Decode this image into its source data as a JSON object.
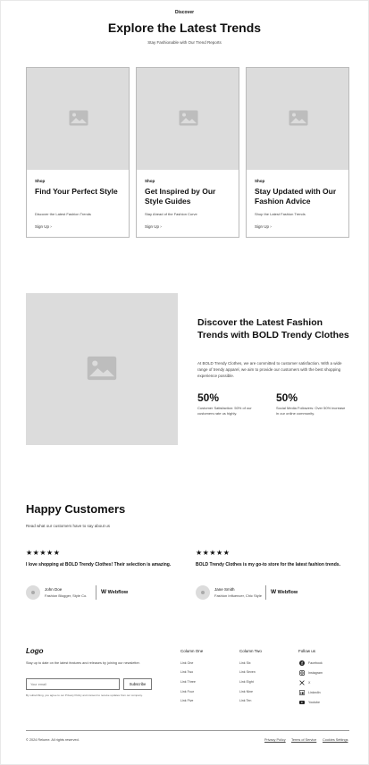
{
  "hero": {
    "eyebrow": "Discover",
    "title": "Explore the Latest Trends",
    "subtitle": "Stay Fashionable with Our Trend Reports"
  },
  "cards": [
    {
      "tag": "Shop",
      "title": "Find Your Perfect Style",
      "desc": "Discover the Latest Fashion Trends",
      "link": "Sign Up"
    },
    {
      "tag": "Shop",
      "title": "Get Inspired by Our Style Guides",
      "desc": "Stay Ahead of the Fashion Curve",
      "link": "Sign Up"
    },
    {
      "tag": "Shop",
      "title": "Stay Updated with Our Fashion Advice",
      "desc": "Shop the Latest Fashion Trends",
      "link": "Sign Up"
    }
  ],
  "feature": {
    "title": "Discover the Latest Fashion Trends with BOLD Trendy Clothes",
    "desc": "At BOLD Trendy Clothes, we are committed to customer satisfaction. With a wide range of trendy apparel, we aim to provide our customers with the best shopping experience possible.",
    "stats": [
      {
        "num": "50%",
        "label": "Customer Satisfaction: 50% of our customers rate us highly."
      },
      {
        "num": "50%",
        "label": "Social Media Followers: Over 50% increase in our online community."
      }
    ]
  },
  "testimonials": {
    "title": "Happy Customers",
    "subtitle": "Read what our customers have to say about us",
    "stars": "★★★★★",
    "items": [
      {
        "quote": "I love shopping at BOLD Trendy Clothes! Their selection is amazing.",
        "name": "John Doe",
        "role": "Fashion Blogger, Style Co.",
        "company": "Webflow"
      },
      {
        "quote": "BOLD Trendy Clothes is my go-to store for the latest fashion trends.",
        "name": "Jane Smith",
        "role": "Fashion Influencer, Chic Style",
        "company": "Webflow"
      }
    ]
  },
  "footer": {
    "logo": "Logo",
    "desc": "Stay up to date on the latest features and releases by joining our newsletter.",
    "email_placeholder": "Your email",
    "subscribe": "Subscribe",
    "fine_print": "By subscribing, you agree to our Privacy Policy and consent to receive updates from our company.",
    "col1": {
      "title": "Column One",
      "links": [
        "Link One",
        "Link Two",
        "Link Three",
        "Link Four",
        "Link Five"
      ]
    },
    "col2": {
      "title": "Column Two",
      "links": [
        "Link Six",
        "Link Seven",
        "Link Eight",
        "Link Nine",
        "Link Ten"
      ]
    },
    "follow": {
      "title": "Follow us",
      "links": [
        "Facebook",
        "Instagram",
        "X",
        "LinkedIn",
        "Youtube"
      ]
    },
    "copyright": "© 2024 Relume. All rights reserved.",
    "legal": [
      "Privacy Policy",
      "Terms of Service",
      "Cookies Settings"
    ]
  }
}
